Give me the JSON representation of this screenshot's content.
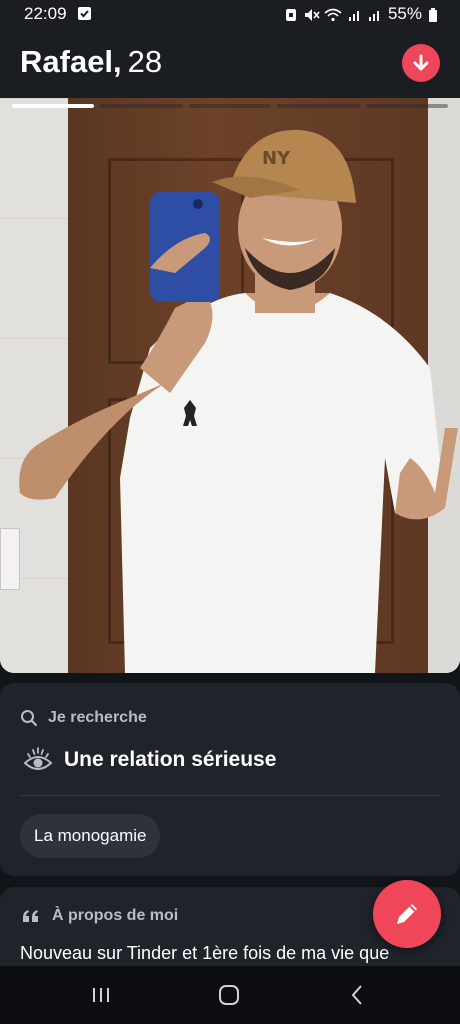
{
  "status_bar": {
    "time": "22:09",
    "battery": "55%"
  },
  "header": {
    "name": "Rafael,",
    "age": "28",
    "accent": "#f0465a"
  },
  "photo": {
    "segments_total": 5,
    "active_segment": 1
  },
  "looking_for": {
    "heading": "Je recherche",
    "relationship": "Une relation sérieuse",
    "chip": "La monogamie"
  },
  "about": {
    "heading": "À propos de moi",
    "text": "Nouveau sur Tinder et 1ère fois de ma vie que"
  },
  "icons": {
    "header_action": "arrow-down-icon",
    "search": "search-icon",
    "eye": "eye-icon",
    "quote": "quote-icon",
    "edit": "pencil-icon"
  }
}
